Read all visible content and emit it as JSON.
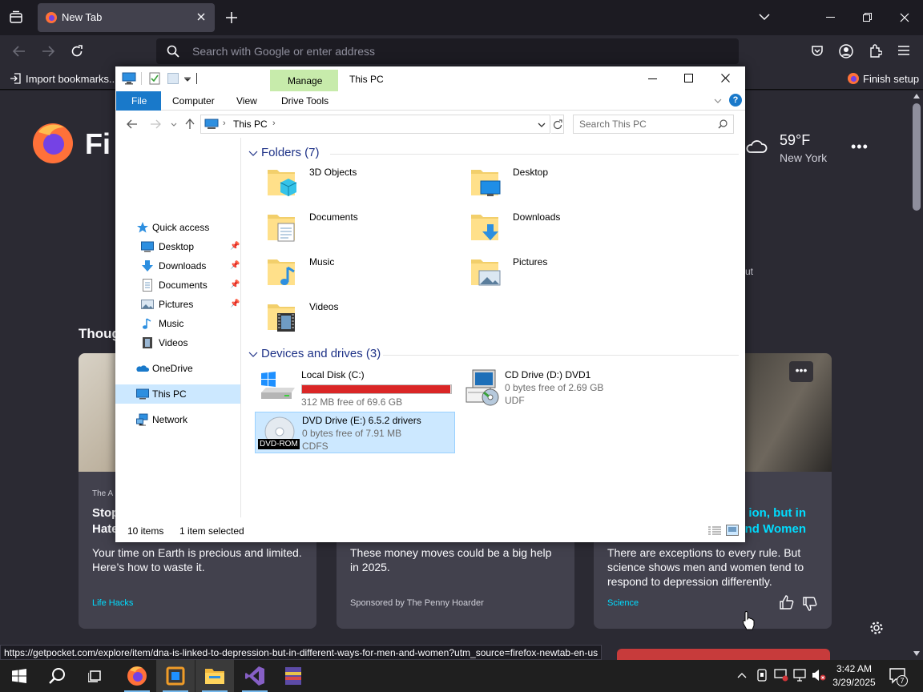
{
  "browser": {
    "tab_title": "New Tab",
    "url_placeholder": "Search with Google or enter address",
    "bookmarks_import": "Import bookmarks...",
    "finish_setup": "Finish setup",
    "status_url": "https://getpocket.com/explore/item/dna-is-linked-to-depression-but-in-different-ways-for-men-and-women?utm_source=firefox-newtab-en-us"
  },
  "newtab": {
    "logo_text_partial": "Fi",
    "weather": {
      "temp": "59°F",
      "city": "New York"
    },
    "section_partial": "Thoug",
    "partial_right_text": "ut",
    "cards": [
      {
        "source_top": "The A",
        "title": "Stop\nHate",
        "desc": "Your time on Earth is precious and limited. Here’s how to waste it.",
        "source": "Life Hacks"
      },
      {
        "title": "",
        "desc": "These money moves could be a big help in 2025.",
        "source": "Sponsored by The Penny Hoarder"
      },
      {
        "title": "ion, but in\nnd Women",
        "desc": "There are exceptions to every rule. But science shows men and women tend to respond to depression differently.",
        "source": "Science"
      }
    ]
  },
  "explorer": {
    "title": "This PC",
    "manage_tab": "Manage",
    "ribbon_tabs": {
      "file": "File",
      "computer": "Computer",
      "view": "View",
      "drive_tools": "Drive Tools"
    },
    "address_path": "This PC",
    "search_placeholder": "Search This PC",
    "nav": {
      "quick_access": "Quick access",
      "desktop": "Desktop",
      "downloads": "Downloads",
      "documents": "Documents",
      "pictures": "Pictures",
      "music": "Music",
      "videos": "Videos",
      "onedrive": "OneDrive",
      "this_pc": "This PC",
      "network": "Network"
    },
    "folders_header": "Folders (7)",
    "folders": [
      "3D Objects",
      "Desktop",
      "Documents",
      "Downloads",
      "Music",
      "Pictures",
      "Videos"
    ],
    "drives_header": "Devices and drives (3)",
    "drives": {
      "c": {
        "name": "Local Disk (C:)",
        "free": "312 MB free of 69.6 GB",
        "used_fraction": 0.996
      },
      "d": {
        "name": "CD Drive (D:) DVD1",
        "free": "0 bytes free of 2.69 GB",
        "fs": "UDF"
      },
      "e": {
        "name": "DVD Drive (E:) 6.5.2 drivers",
        "free": "0 bytes free of 7.91 MB",
        "fs": "CDFS",
        "badge": "DVD-ROM"
      }
    },
    "status_items": "10 items",
    "status_selected": "1 item selected"
  },
  "taskbar": {
    "time": "3:42 AM",
    "date": "3/29/2025",
    "notif_count": "7"
  },
  "colors": {
    "accent_blue": "#1979ca",
    "manage_green": "#c7ebab",
    "disk_red": "#da2626",
    "selection": "#cce8ff",
    "firefox_link": "#00ddff"
  }
}
